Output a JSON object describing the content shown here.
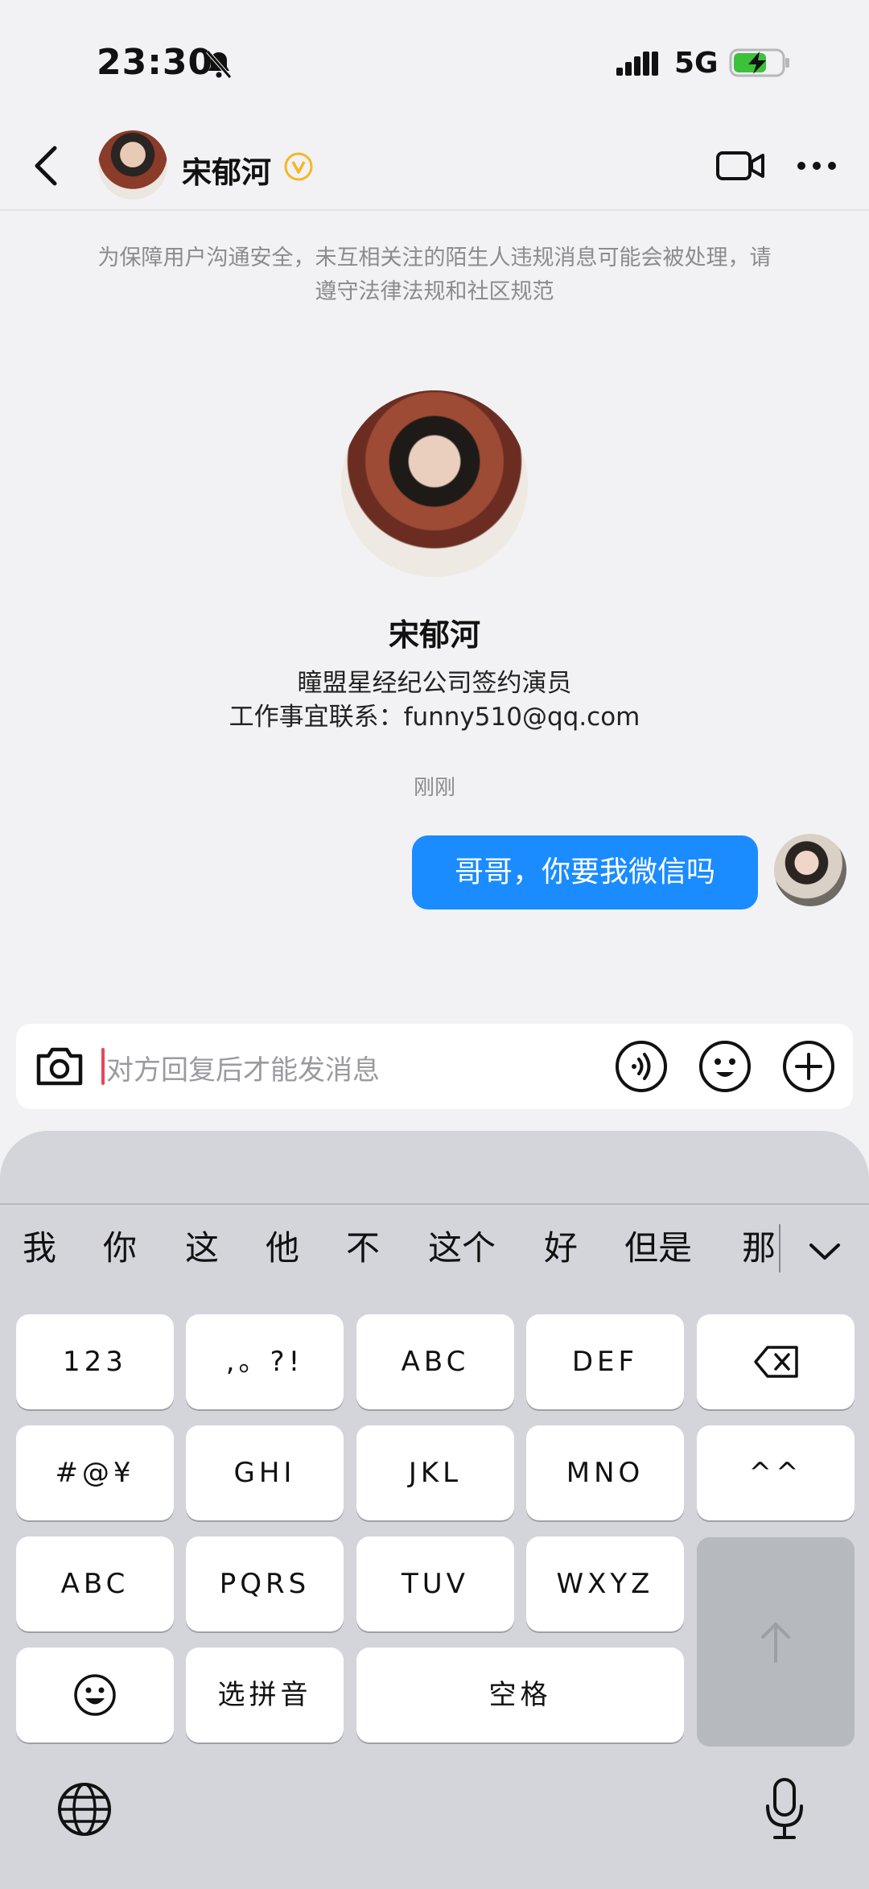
{
  "status_bar": {
    "time": "23:30",
    "network": "5G",
    "battery_color": "#3cc13b"
  },
  "header": {
    "contact_name": "宋郁河",
    "verified_color": "#f5b723"
  },
  "notice": "为保障用户沟通安全，未互相关注的陌生人违规消息可能会被处理，请遵守法律法规和社区规范",
  "profile": {
    "name": "宋郁河",
    "bio_line1": "瞳盟星经纪公司签约演员",
    "bio_line2": "工作事宜联系：funny510@qq.com"
  },
  "chat": {
    "timestamp": "刚刚",
    "messages": [
      {
        "from": "me",
        "text": "哥哥，你要我微信吗",
        "bubble_color": "#1a8cff"
      }
    ]
  },
  "input": {
    "placeholder": "对方回复后才能发消息"
  },
  "keyboard": {
    "candidates": [
      "我",
      "你",
      "这",
      "他",
      "不",
      "这个",
      "好",
      "但是",
      "那"
    ],
    "rows": [
      [
        "123",
        ",。?!",
        "ABC",
        "DEF"
      ],
      [
        "#@¥",
        "GHI",
        "JKL",
        "MNO",
        "^^"
      ],
      [
        "ABC",
        "PQRS",
        "TUV",
        "WXYZ"
      ],
      [
        "选拼音",
        "空格"
      ]
    ],
    "icons": [
      "delete-icon",
      "emoji-key-icon",
      "return-arrow-icon",
      "globe-icon",
      "microphone-icon"
    ]
  }
}
